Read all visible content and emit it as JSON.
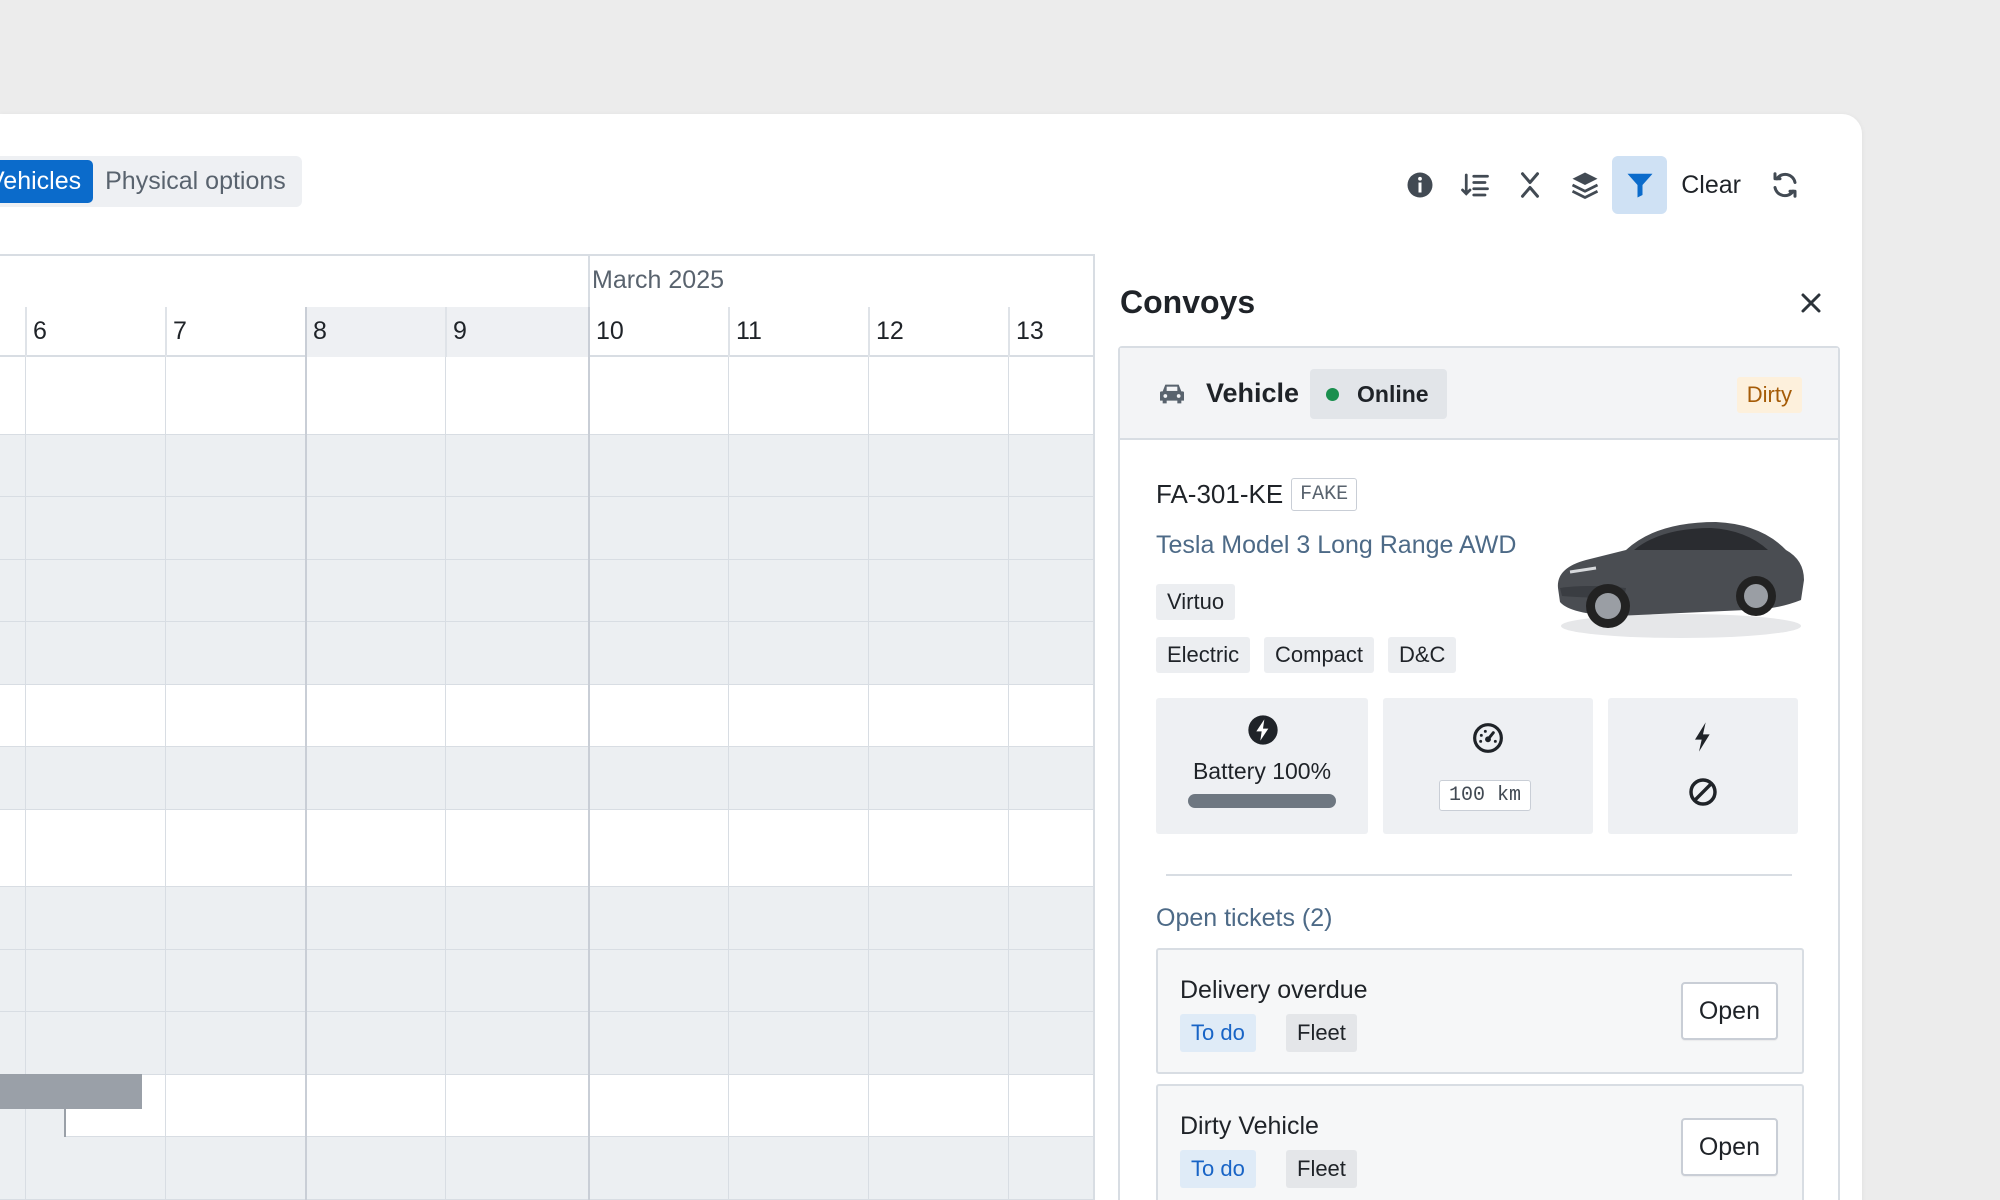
{
  "toolbar": {
    "segments": [
      {
        "label": "Vehicles",
        "active": true
      },
      {
        "label": "Physical options",
        "active": false
      }
    ],
    "icons": [
      "info-icon",
      "sort-icon",
      "collapse-icon",
      "layers-icon",
      "filter-icon",
      "refresh-icon"
    ],
    "filter_active": true,
    "clear_label": "Clear"
  },
  "calendar": {
    "month_label": "March 2025",
    "days": [
      "6",
      "7",
      "8",
      "9",
      "10",
      "11",
      "12",
      "13"
    ]
  },
  "panel": {
    "title": "Convoys",
    "header": {
      "icon": "car-icon",
      "title": "Vehicle",
      "status": "Online",
      "status_color": "#1a8f4e",
      "badge": "Dirty"
    },
    "vehicle": {
      "plate": "FA-301-KE",
      "plate_badge": "FAKE",
      "model": "Tesla Model 3 Long Range AWD",
      "brand": "Virtuo",
      "tags": [
        "Electric",
        "Compact",
        "D&C"
      ]
    },
    "stats": {
      "battery_label": "Battery 100%",
      "battery_level": 1.0,
      "range_value": "100 km",
      "charging_icon": "bolt-icon",
      "charging_state_icon": "prohibited-icon"
    },
    "tickets": {
      "title": "Open tickets (2)",
      "items": [
        {
          "title": "Delivery overdue",
          "status": "To do",
          "category": "Fleet",
          "action": "Open"
        },
        {
          "title": "Dirty Vehicle",
          "status": "To do",
          "category": "Fleet",
          "action": "Open"
        }
      ]
    }
  },
  "colors": {
    "accent": "#0b6bcb",
    "dirty_bg": "#fdf0dc",
    "dirty_text": "#a55b07",
    "todo_text": "#1864c6"
  }
}
